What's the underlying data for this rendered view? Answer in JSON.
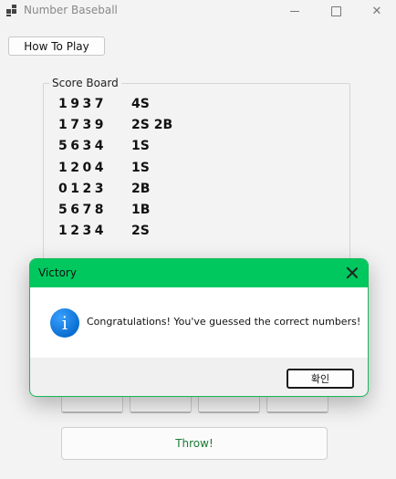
{
  "window": {
    "title": "Number Baseball",
    "minimize_glyph": "minimize-icon",
    "maximize_glyph": "maximize-icon",
    "close_glyph": "✕"
  },
  "toolbar": {
    "how_to_play_label": "How To Play"
  },
  "scoreboard": {
    "legend": "Score Board",
    "rows": [
      {
        "number": "1937",
        "result": "4S"
      },
      {
        "number": "1739",
        "result": "2S 2B"
      },
      {
        "number": "5634",
        "result": "1S"
      },
      {
        "number": "1204",
        "result": "1S"
      },
      {
        "number": "0123",
        "result": "2B"
      },
      {
        "number": "5678",
        "result": "1B"
      },
      {
        "number": "1234",
        "result": "2S"
      }
    ]
  },
  "inputs": {
    "digit_count": 4
  },
  "throw_button": {
    "label": "Throw!",
    "color": "#1d7a36"
  },
  "dialog": {
    "title": "Victory",
    "message": "Congratulations! You've guessed the correct numbers!",
    "ok_label": "확인",
    "title_bar_color": "#00c85e",
    "icon": "info-icon"
  }
}
